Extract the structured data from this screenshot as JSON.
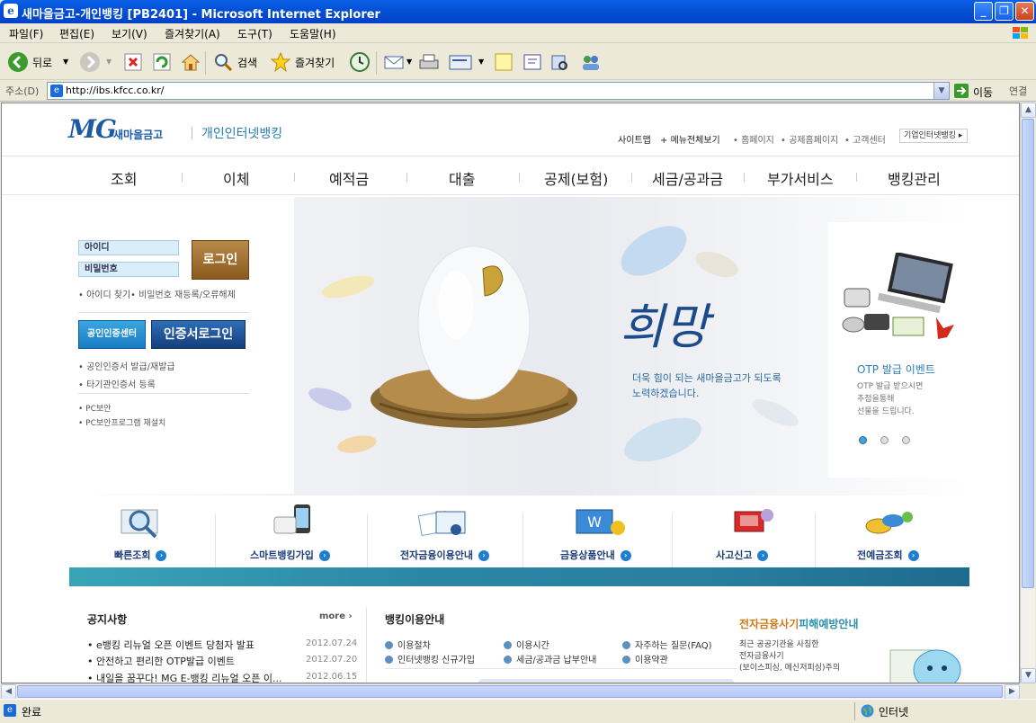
{
  "window": {
    "title": "새마을금고-개인뱅킹 [PB2401] - Microsoft Internet Explorer"
  },
  "menu": [
    "파일(F)",
    "편집(E)",
    "보기(V)",
    "즐겨찾기(A)",
    "도구(T)",
    "도움말(H)"
  ],
  "toolbar": {
    "back": "뒤로",
    "search": "검색",
    "favorites": "즐겨찾기"
  },
  "address": {
    "label": "주소(D)",
    "url": "http://ibs.kfcc.co.kr/",
    "go": "이동",
    "links": "연결"
  },
  "status": {
    "text": "완료",
    "zone": "인터넷"
  },
  "site": {
    "logo_mg": "MG",
    "logo_name": "새마을금고",
    "logo_sub": "개인인터넷뱅킹",
    "util": {
      "sitemap": "사이트맵",
      "allmenu": "메뉴전체보기",
      "home": "홈페이지",
      "mutual": "공제홈페이지",
      "customer": "고객센터",
      "corp": "기업인터넷뱅킹"
    },
    "nav": [
      "조회",
      "이체",
      "예적금",
      "대출",
      "공제(보험)",
      "세금/공과금",
      "부가서비스",
      "뱅킹관리"
    ],
    "login": {
      "id_label": "아이디",
      "pw_label": "비밀번호",
      "login_btn": "로그인",
      "find_id": "아이디 찾기",
      "reset_pw": "비밀번호 재등록/오류해제",
      "cert_center": "공인인증센터",
      "cert_login": "인증서로그인",
      "cert_issue": "공인인증서 발급/재발급",
      "cert_other": "타기관인증서 등록",
      "pc_sec": "PC보안",
      "pc_reinstall": "PC보안프로그램 재설치"
    },
    "hero": {
      "word": "희망",
      "line1": "더욱 힘이 되는 새마을금고가 되도록",
      "line2": "노력하겠습니다."
    },
    "otp": {
      "title": "OTP 발급 이벤트",
      "line1": "OTP 발급 받으시면",
      "line2": "추첨을통해",
      "line3": "선물을 드립니다."
    },
    "quick": [
      "빠른조회",
      "스마트뱅킹가입",
      "전자금융이용안내",
      "금융상품안내",
      "사고신고",
      "전예금조회"
    ],
    "notice": {
      "title": "공지사항",
      "more": "more",
      "items": [
        {
          "text": "e뱅킹 리뉴얼 오픈 이벤트 당첨자 발표",
          "date": "2012.07.24"
        },
        {
          "text": "안전하고 편리한 OTP발급 이벤트",
          "date": "2012.07.20"
        },
        {
          "text": "내일을 꿈꾸다! MG E-뱅킹 리뉴얼 오픈 이...",
          "date": "2012.06.15"
        }
      ]
    },
    "guide": {
      "title": "뱅킹이용안내",
      "items": [
        "이용절차",
        "이용시간",
        "자주하는 질문(FAQ)",
        "인터넷뱅킹 신규가입",
        "세금/공과금 납부안내",
        "이용약관"
      ]
    },
    "fraud": {
      "title_a": "전자금융사기",
      "title_b": "피해예방안내",
      "line1": "최근 공공기관을 사칭한",
      "line2": "전자금융사기",
      "line3": "(보이스피싱, 메신저피싱)주의"
    }
  },
  "colors": {
    "brand_blue": "#1c5aa6",
    "accent_teal": "#2a8fb0",
    "login_brown": "#9a6a2c"
  }
}
